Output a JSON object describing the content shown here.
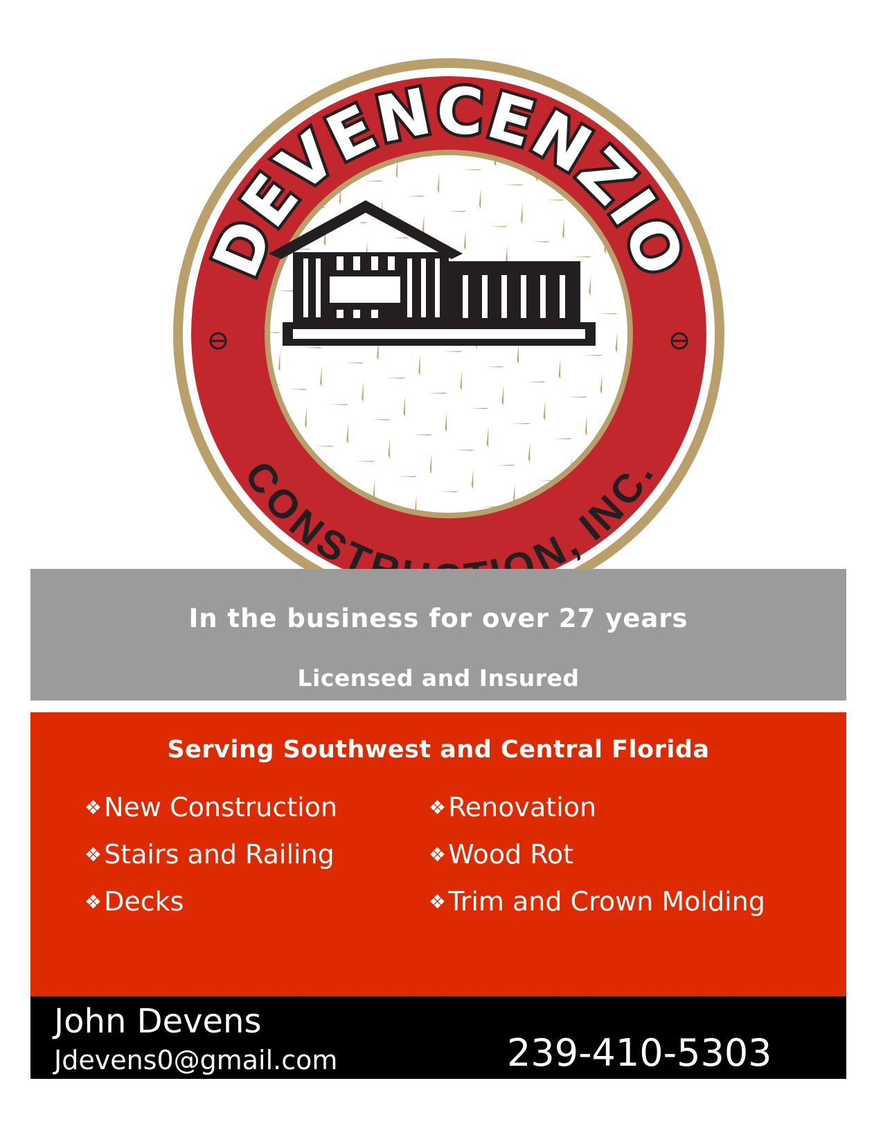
{
  "logo": {
    "brand_name": "DEVENCENZIO",
    "company_suffix": "CONSTRUCTION, INC.",
    "colors": {
      "ring_red": "#c1272d",
      "gold": "#b9a06b",
      "house": "#231f20",
      "white": "#ffffff"
    }
  },
  "banner": {
    "tagline": "In the business for over 27 years",
    "credential": "Licensed and Insured"
  },
  "services": {
    "heading": "Serving Southwest and Central Florida",
    "bullet": "❖",
    "left_column": [
      "New Construction",
      "Stairs and Railing",
      "Decks"
    ],
    "right_column": [
      "Renovation",
      "Wood Rot",
      "Trim and Crown Molding"
    ]
  },
  "contact": {
    "name": "John Devens",
    "email": "Jdevens0@gmail.com",
    "phone": "239-410-5303"
  },
  "colors": {
    "gray_band": "#9b9b9b",
    "red_band": "#dd2a00",
    "black_band": "#000000",
    "text": "#ffffff"
  }
}
